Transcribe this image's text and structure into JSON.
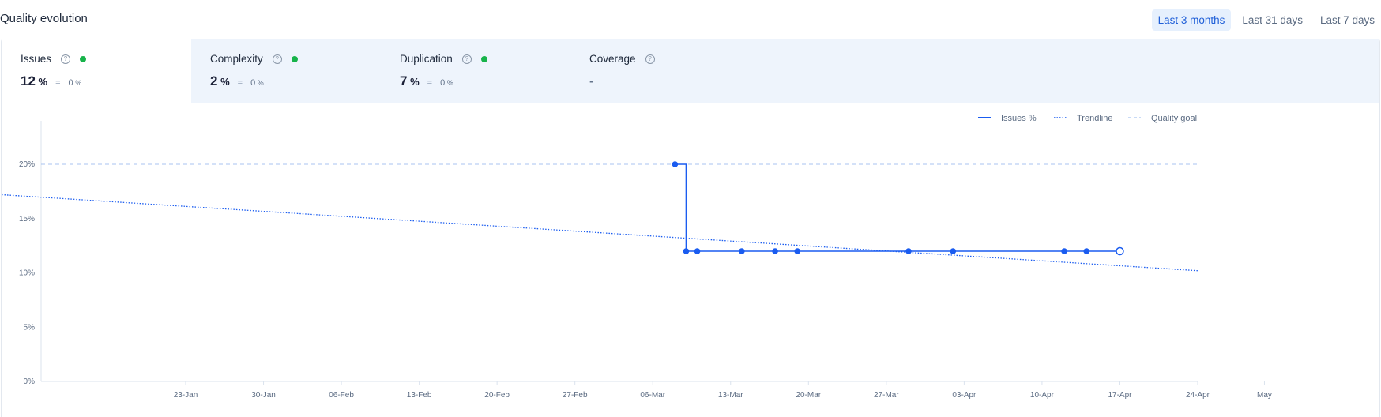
{
  "header": {
    "title": "Quality evolution",
    "ranges": [
      {
        "label": "Last 3 months",
        "active": true
      },
      {
        "label": "Last 31 days",
        "active": false
      },
      {
        "label": "Last 7 days",
        "active": false
      }
    ]
  },
  "metrics": [
    {
      "name": "Issues",
      "value": "12",
      "unit": "%",
      "eq": "=",
      "delta": "0",
      "delta_unit": "%",
      "status": "good",
      "active": true
    },
    {
      "name": "Complexity",
      "value": "2",
      "unit": "%",
      "eq": "=",
      "delta": "0",
      "delta_unit": "%",
      "status": "good",
      "active": false
    },
    {
      "name": "Duplication",
      "value": "7",
      "unit": "%",
      "eq": "=",
      "delta": "0",
      "delta_unit": "%",
      "status": "good",
      "active": false
    },
    {
      "name": "Coverage",
      "value": "-",
      "status": "none",
      "active": false
    }
  ],
  "colors": {
    "accent": "#1a5cf0",
    "status_good": "#17b34a",
    "goal": "#a8c3f0",
    "axis_text": "#5b6b82"
  },
  "chart_data": {
    "type": "line",
    "legend": [
      "Issues %",
      "Trendline",
      "Quality goal"
    ],
    "legend_position": "top-right",
    "x_tick_labels": [
      "23-Jan",
      "30-Jan",
      "06-Feb",
      "13-Feb",
      "20-Feb",
      "27-Feb",
      "06-Mar",
      "13-Mar",
      "20-Mar",
      "27-Mar",
      "03-Apr",
      "10-Apr",
      "17-Apr",
      "24-Apr",
      "May"
    ],
    "y_tick_labels": [
      "0%",
      "5%",
      "10%",
      "15%",
      "20%"
    ],
    "y_ticks": [
      0,
      5,
      10,
      15,
      20
    ],
    "ylim": [
      0,
      24
    ],
    "xlim_days": [
      -6,
      98
    ],
    "x_tick_days": [
      7,
      14,
      21,
      28,
      35,
      42,
      49,
      56,
      63,
      70,
      77,
      84,
      91,
      98,
      104
    ],
    "quality_goal": 20,
    "trendline": {
      "start": [
        -6,
        17.2
      ],
      "end": [
        98,
        10.2
      ]
    },
    "series": [
      {
        "name": "Issues %",
        "style": "step",
        "points": [
          {
            "x": 51,
            "y": 20
          },
          {
            "x": 52,
            "y": 12
          },
          {
            "x": 53,
            "y": 12
          },
          {
            "x": 57,
            "y": 12
          },
          {
            "x": 60,
            "y": 12
          },
          {
            "x": 62,
            "y": 12
          },
          {
            "x": 72,
            "y": 12
          },
          {
            "x": 76,
            "y": 12
          },
          {
            "x": 86,
            "y": 12
          },
          {
            "x": 88,
            "y": 12
          },
          {
            "x": 91,
            "y": 12
          }
        ],
        "last_point_hollow": true
      }
    ]
  }
}
